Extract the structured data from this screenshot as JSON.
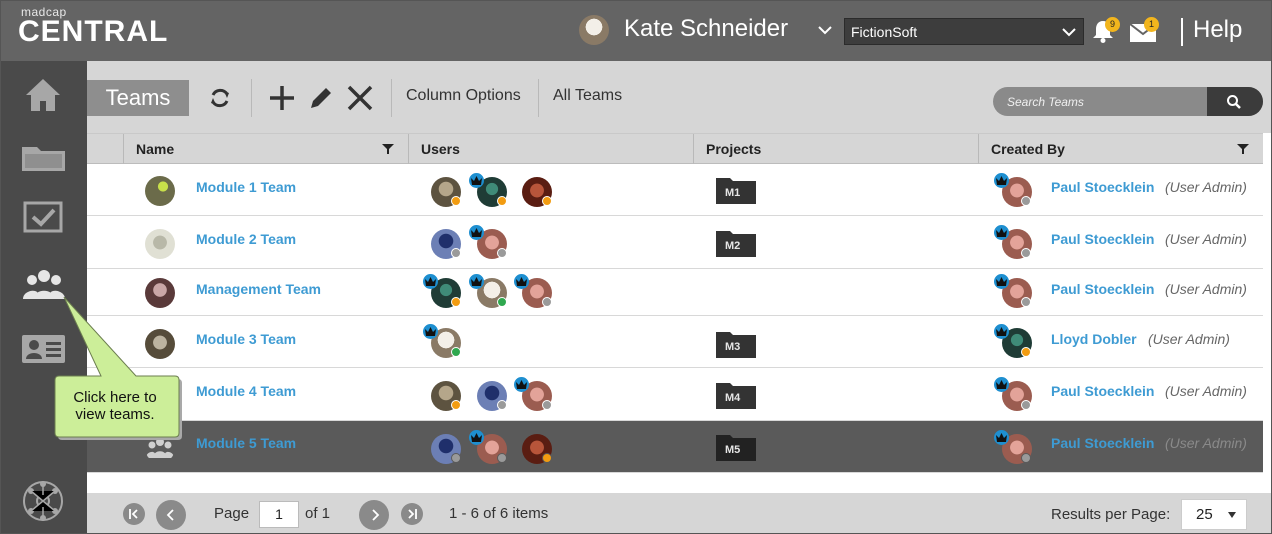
{
  "app": {
    "logo_small": "madcap",
    "logo_big": "CENTRAL",
    "user_name": "Kate Schneider",
    "organization": "FictionSoft",
    "notifications_count": "9",
    "messages_count": "1",
    "help_label": "Help"
  },
  "sidenav": {
    "items": [
      "home-icon",
      "projects-icon",
      "tasks-icon",
      "teams-icon",
      "users-icon",
      "network-icon"
    ]
  },
  "toolbar": {
    "title": "Teams",
    "column_options": "Column Options",
    "all_teams": "All Teams",
    "search_placeholder": "Search Teams"
  },
  "table": {
    "headers": {
      "name": "Name",
      "users": "Users",
      "projects": "Projects",
      "created_by": "Created By"
    },
    "rows": [
      {
        "name": "Module 1 Team",
        "project": "M1",
        "creator": "Paul Stoecklein",
        "role": "(User Admin)"
      },
      {
        "name": "Module 2 Team",
        "project": "M2",
        "creator": "Paul Stoecklein",
        "role": "(User Admin)"
      },
      {
        "name": "Management Team",
        "project": "",
        "creator": "Paul Stoecklein",
        "role": "(User Admin)"
      },
      {
        "name": "Module 3 Team",
        "project": "M3",
        "creator": "Lloyd Dobler",
        "role": "(User Admin)"
      },
      {
        "name": "Module 4 Team",
        "project": "M4",
        "creator": "Paul Stoecklein",
        "role": "(User Admin)"
      },
      {
        "name": "Module 5 Team",
        "project": "M5",
        "creator": "Paul Stoecklein",
        "role": "(User Admin)"
      }
    ]
  },
  "pager": {
    "page_label": "Page",
    "page_value": "1",
    "of_label": "of 1",
    "items_label": "1 - 6 of 6 items",
    "results_label": "Results per Page:",
    "results_value": "25"
  },
  "callout": {
    "text": "Click here to view teams."
  },
  "colors": {
    "accent": "#3e9bd3",
    "crown": "#1e8fd0",
    "status_away": "#f29c11",
    "status_online": "#2fa84f",
    "status_offline": "#9a9a9a",
    "callout": "#ccee99"
  }
}
